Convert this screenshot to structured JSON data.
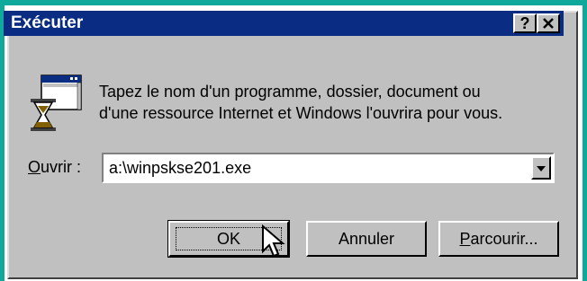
{
  "window": {
    "title": "Exécuter",
    "help_label": "?",
    "close_label": "✕"
  },
  "description": {
    "line1": "Tapez le nom d'un programme, dossier, document ou",
    "line2": "d'une ressource Internet et Windows l'ouvrira pour vous."
  },
  "open_field": {
    "label_underlined": "O",
    "label_rest": "uvrir :",
    "value": "a:\\winpskse201.exe"
  },
  "buttons": {
    "ok": "OK",
    "cancel": "Annuler",
    "browse_underlined": "P",
    "browse_rest": "arcourir..."
  },
  "icons": {
    "run": "run-program-icon",
    "dropdown": "chevron-down-icon",
    "cursor": "mouse-pointer-icon"
  },
  "colors": {
    "titlebar": "#0a2c83",
    "dialog_bg": "#c0c0c0",
    "frame_accent": "#0fa99c"
  }
}
